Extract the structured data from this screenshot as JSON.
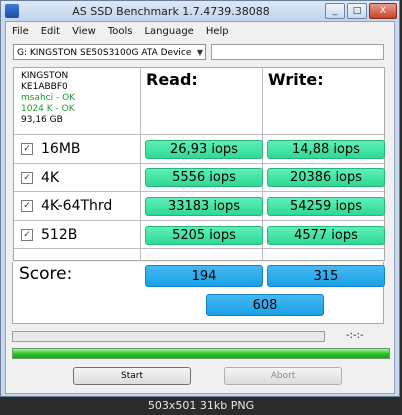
{
  "window": {
    "title": "AS SSD Benchmark 1.7.4739.38088",
    "controls": {
      "minimize": "_",
      "maximize": "□",
      "close": "X"
    }
  },
  "menu": [
    {
      "label": "File"
    },
    {
      "label": "Edit"
    },
    {
      "label": "View"
    },
    {
      "label": "Tools"
    },
    {
      "label": "Language"
    },
    {
      "label": "Help"
    }
  ],
  "drive": {
    "selected": "G: KINGSTON SE50S3100G ATA Device",
    "arrow": "▼"
  },
  "info": {
    "model": "KINGSTON",
    "firmware": "KE1ABBF0",
    "driver": "msahci - OK",
    "alignment": "1024 K - OK",
    "size": "93,16 GB"
  },
  "headers": {
    "read": "Read:",
    "write": "Write:"
  },
  "rows": [
    {
      "label": "16MB",
      "read": "26,93 iops",
      "write": "14,88 iops"
    },
    {
      "label": "4K",
      "read": "5556 iops",
      "write": "20386 iops"
    },
    {
      "label": "4K-64Thrd",
      "read": "33183 iops",
      "write": "54259 iops"
    },
    {
      "label": "512B",
      "read": "5205 iops",
      "write": "4577 iops"
    }
  ],
  "checkmark": "✓",
  "score": {
    "label": "Score:",
    "read": "194",
    "write": "315",
    "total": "608"
  },
  "progress": {
    "top_fraction": 0,
    "top_time": "-:-:-",
    "bottom_fraction": 1
  },
  "buttons": {
    "start": "Start",
    "abort": "Abort"
  },
  "status_bar": "503x501 31kb PNG"
}
